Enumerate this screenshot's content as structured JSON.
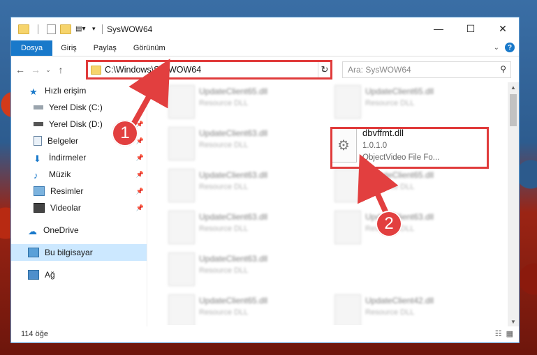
{
  "window": {
    "title": "SysWOW64",
    "controls": {
      "minimize": "—",
      "maximize": "☐",
      "close": "✕"
    }
  },
  "ribbon": {
    "tabs": [
      "Dosya",
      "Giriş",
      "Paylaş",
      "Görünüm"
    ],
    "help": "?"
  },
  "address": {
    "path": "C:\\Windows\\SysWOW64",
    "search_placeholder": "Ara: SysWOW64"
  },
  "sidebar": {
    "quick_access": "Hızlı erişim",
    "items": [
      {
        "label": "Yerel Disk (C:)",
        "icon": "drive-icon",
        "pinned": false
      },
      {
        "label": "Yerel Disk (D:)",
        "icon": "drive-icon",
        "pinned": true
      },
      {
        "label": "Belgeler",
        "icon": "documents-icon",
        "pinned": true
      },
      {
        "label": "İndirmeler",
        "icon": "download-icon",
        "pinned": true
      },
      {
        "label": "Müzik",
        "icon": "music-icon",
        "pinned": true
      },
      {
        "label": "Resimler",
        "icon": "pictures-icon",
        "pinned": true
      },
      {
        "label": "Videolar",
        "icon": "videos-icon",
        "pinned": true
      }
    ],
    "onedrive": "OneDrive",
    "this_pc": "Bu bilgisayar",
    "network": "Ağ"
  },
  "files_blurred": [
    {
      "name": "UpdateClient65.dll",
      "type": "Resource DLL"
    },
    {
      "name": "UpdateClient65.dll",
      "type": "Resource DLL"
    },
    {
      "name": "UpdateClient63.dll",
      "type": "Resource DLL"
    },
    {
      "name": "UpdateClient63.dll",
      "type": "Resource DLL"
    },
    {
      "name": "UpdateClient65.dll",
      "type": "Resource DLL"
    },
    {
      "name": "UpdateClient63.dll",
      "type": "Resource DLL"
    },
    {
      "name": "UpdateClient63.dll",
      "type": "Resource DLL"
    },
    {
      "name": "UpdateClient63.dll",
      "type": "Resource DLL"
    },
    {
      "name": "UpdateClient65.dll",
      "type": "Resource DLL"
    },
    {
      "name": "UpdateClient42.dll",
      "type": "Resource DLL"
    }
  ],
  "target_file": {
    "name": "dbvffmt.dll",
    "version": "1.0.1.0",
    "description": "ObjectVideo File Fo..."
  },
  "status": {
    "count": "114 öğe"
  },
  "annotations": {
    "step1": "1",
    "step2": "2"
  },
  "colors": {
    "accent": "#1979ca",
    "highlight": "#e03b3b",
    "selected": "#cce8ff"
  }
}
